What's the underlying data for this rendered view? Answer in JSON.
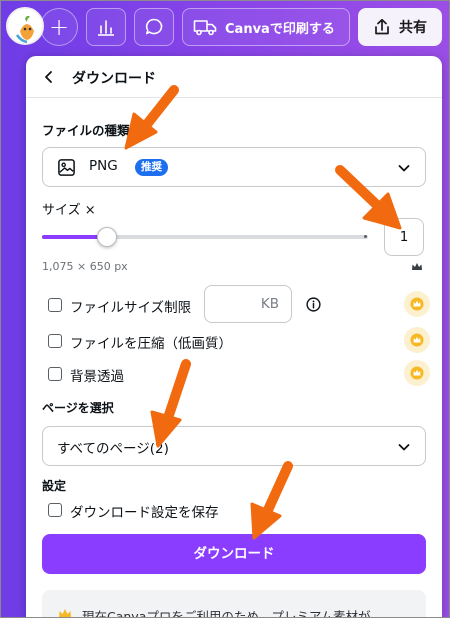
{
  "topbar": {
    "plus_label": "+",
    "print_label": "Canvaで印刷する",
    "share_label": "共有"
  },
  "panel": {
    "title": "ダウンロード",
    "file_type": {
      "label": "ファイルの種類",
      "value": "PNG",
      "badge": "推奨"
    },
    "size": {
      "label": "サイズ ×",
      "slider_value_fraction": 0.2,
      "value": "1",
      "dimensions": "1,075 × 650 px"
    },
    "options": [
      {
        "label": "ファイルサイズ制限",
        "checked": false,
        "input_unit": "KB",
        "premium": true
      },
      {
        "label": "ファイルを圧縮（低画質）",
        "checked": false,
        "premium": true
      },
      {
        "label": "背景透過",
        "checked": false,
        "premium": true
      }
    ],
    "pages": {
      "label": "ページを選択",
      "value": "すべてのページ(2)"
    },
    "settings": {
      "label": "設定",
      "save_label": "ダウンロード設定を保存"
    },
    "download_button": "ダウンロード",
    "notice": "現在Canvaプロをご利用のため、プレミアム素材が"
  },
  "colors": {
    "accent": "#8b3dff",
    "badge": "#1d6ff0",
    "arrow": "#f26a0f",
    "crown": "#f7b825"
  }
}
